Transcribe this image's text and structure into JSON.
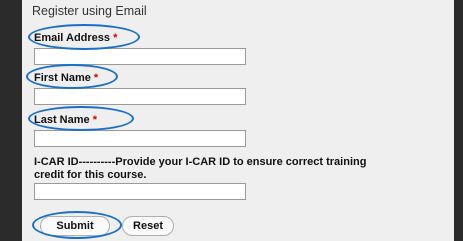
{
  "form": {
    "section_title": "Register using Email",
    "required_marker": "*",
    "email_label": "Email Address",
    "email_value": "",
    "first_name_label": "First Name",
    "first_name_value": "",
    "last_name_label": "Last Name",
    "last_name_value": "",
    "icar_label": "I-CAR ID----------Provide your I-CAR ID to ensure correct training credit for this course.",
    "icar_value": "",
    "submit_label": "Submit",
    "reset_label": "Reset"
  },
  "colors": {
    "required": "#e00000",
    "highlight_circle": "#1a6fc9",
    "background_dark": "#2b2b2b",
    "panel": "#efefef"
  }
}
